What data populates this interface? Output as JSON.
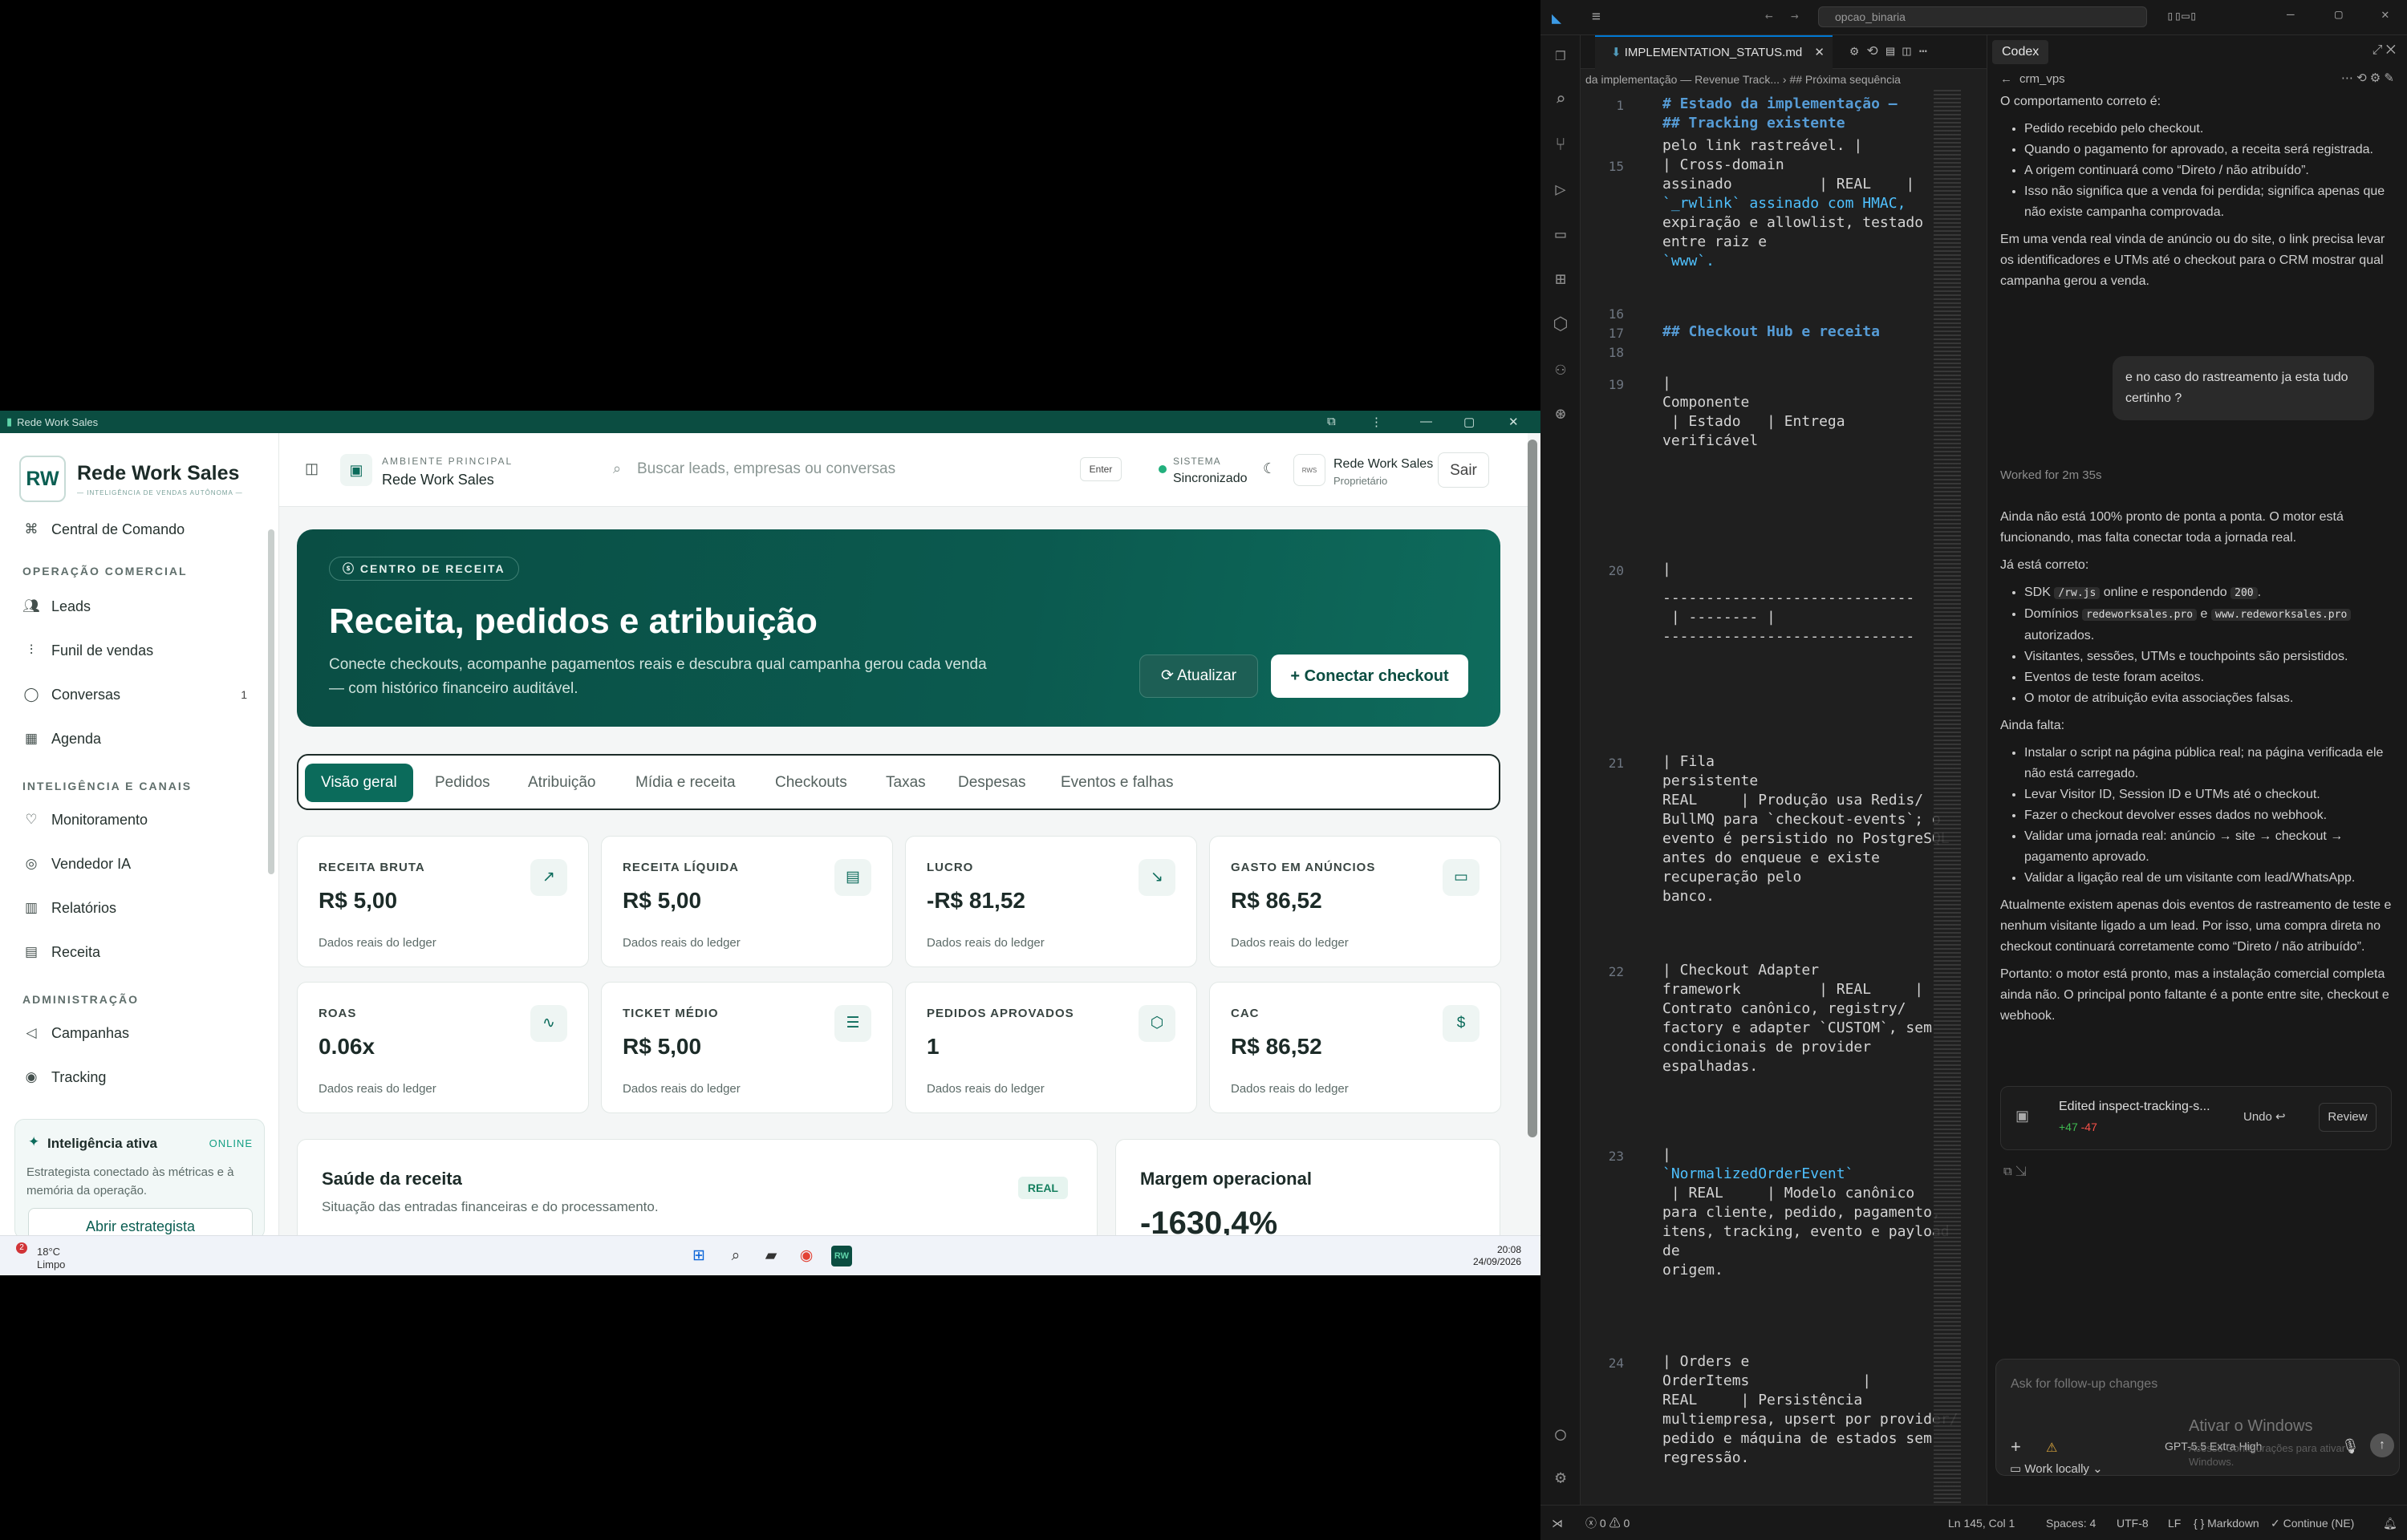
{
  "crm": {
    "window_title": "Rede Work Sales",
    "logo_initials": "RW",
    "logo_name": "Rede Work Sales",
    "logo_tagline": "— INTELIGÊNCIA DE VENDAS AUTÔNOMA —",
    "sidebar": {
      "top_item": "Central de Comando",
      "sections": [
        {
          "label": "OPERAÇÃO COMERCIAL",
          "items": [
            {
              "label": "Leads",
              "icon": "users-icon"
            },
            {
              "label": "Funil de vendas",
              "icon": "funnel-icon"
            },
            {
              "label": "Conversas",
              "icon": "chat-icon",
              "count": "1"
            },
            {
              "label": "Agenda",
              "icon": "calendar-icon"
            }
          ]
        },
        {
          "label": "INTELIGÊNCIA E CANAIS",
          "items": [
            {
              "label": "Monitoramento",
              "icon": "heart-icon"
            },
            {
              "label": "Vendedor IA",
              "icon": "bot-icon"
            },
            {
              "label": "Relatórios",
              "icon": "bar-chart-icon"
            },
            {
              "label": "Receita",
              "icon": "receipt-icon"
            }
          ]
        },
        {
          "label": "ADMINISTRAÇÃO",
          "items": [
            {
              "label": "Campanhas",
              "icon": "megaphone-icon"
            },
            {
              "label": "Tracking",
              "icon": "target-icon"
            }
          ]
        }
      ],
      "ai_card": {
        "title": "Inteligência ativa",
        "status": "ONLINE",
        "desc": "Estrategista conectado às métricas e à memória da operação.",
        "button": "Abrir estrategista"
      }
    },
    "header": {
      "env_label": "AMBIENTE PRINCIPAL",
      "env_value": "Rede Work Sales",
      "search_placeholder": "Buscar leads, empresas ou conversas",
      "enter_key": "Enter",
      "system_label": "SISTEMA",
      "system_value": "Sincronizado",
      "user_name": "Rede Work Sales",
      "user_role": "Proprietário",
      "logout": "Sair"
    },
    "hero": {
      "pill": "CENTRO DE RECEITA",
      "title": "Receita, pedidos e atribuição",
      "subtitle": "Conecte checkouts, acompanhe pagamentos reais e descubra qual campanha gerou cada venda — com histórico financeiro auditável.",
      "btn_refresh": "Atualizar",
      "btn_connect": "Conectar checkout"
    },
    "tabs": [
      "Visão geral",
      "Pedidos",
      "Atribuição",
      "Mídia e receita",
      "Checkouts",
      "Taxas",
      "Despesas",
      "Eventos e falhas"
    ],
    "cards": [
      {
        "title": "RECEITA BRUTA",
        "value": "R$ 5,00",
        "foot": "Dados reais do ledger",
        "icon": "trend-up-icon"
      },
      {
        "title": "RECEITA LÍQUIDA",
        "value": "R$ 5,00",
        "foot": "Dados reais do ledger",
        "icon": "wallet-icon"
      },
      {
        "title": "LUCRO",
        "value": "-R$ 81,52",
        "foot": "Dados reais do ledger",
        "icon": "trend-down-icon"
      },
      {
        "title": "GASTO EM ANÚNCIOS",
        "value": "R$ 86,52",
        "foot": "Dados reais do ledger",
        "icon": "card-icon"
      },
      {
        "title": "ROAS",
        "value": "0.06x",
        "foot": "Dados reais do ledger",
        "icon": "pulse-icon"
      },
      {
        "title": "TICKET MÉDIO",
        "value": "R$ 5,00",
        "foot": "Dados reais do ledger",
        "icon": "ticket-icon"
      },
      {
        "title": "PEDIDOS APROVADOS",
        "value": "1",
        "foot": "Dados reais do ledger",
        "icon": "package-icon"
      },
      {
        "title": "CAC",
        "value": "R$ 86,52",
        "foot": "Dados reais do ledger",
        "icon": "dollar-icon"
      }
    ],
    "health": {
      "title": "Saúde da receita",
      "subtitle": "Situação das entradas financeiras e do processamento.",
      "badge": "REAL"
    },
    "margin": {
      "title": "Margem operacional",
      "value": "-1630,4%"
    }
  },
  "taskbar": {
    "weather_temp": "18°C",
    "weather_desc": "Limpo",
    "weather_badge": "2",
    "time": "20:08",
    "date": "24/09/2026"
  },
  "vscode": {
    "command_center": "opcao_binaria",
    "editor_tab": "IMPLEMENTATION_STATUS.md",
    "breadcrumb": "da implementação — Revenue Track... › ## Próxima sequência",
    "lines": [
      {
        "n": "1",
        "t": "# Estado da implementação —",
        "k": "h"
      },
      {
        "n": "",
        "t": "## Tracking existente",
        "k": "h"
      },
      {
        "n": "",
        "t": "pelo link rastreável. |",
        "k": ""
      },
      {
        "n": "15",
        "t": "| Cross-domain",
        "k": ""
      },
      {
        "n": "",
        "t": "assinado          | REAL    |",
        "k": ""
      },
      {
        "n": "",
        "t": "`_rwlink` assinado com HMAC,",
        "k": "c"
      },
      {
        "n": "",
        "t": "expiração e allowlist, testado",
        "k": ""
      },
      {
        "n": "",
        "t": "entre raiz e",
        "k": ""
      },
      {
        "n": "",
        "t": "`www`.",
        "k": "c"
      },
      {
        "n": "16",
        "t": "",
        "k": ""
      },
      {
        "n": "17",
        "t": "## Checkout Hub e receita",
        "k": "h"
      },
      {
        "n": "18",
        "t": "",
        "k": ""
      },
      {
        "n": "19",
        "t": "|",
        "k": ""
      },
      {
        "n": "",
        "t": "Componente",
        "k": ""
      },
      {
        "n": "",
        "t": " | Estado   | Entrega",
        "k": ""
      },
      {
        "n": "",
        "t": "verificável",
        "k": ""
      },
      {
        "n": "20",
        "t": "|",
        "k": ""
      },
      {
        "n": "",
        "t": "-----------------------------",
        "k": ""
      },
      {
        "n": "",
        "t": " | -------- |",
        "k": ""
      },
      {
        "n": "",
        "t": "-----------------------------",
        "k": ""
      },
      {
        "n": "21",
        "t": "| Fila",
        "k": ""
      },
      {
        "n": "",
        "t": "persistente",
        "k": ""
      },
      {
        "n": "",
        "t": "REAL     | Produção usa Redis/",
        "k": ""
      },
      {
        "n": "",
        "t": "BullMQ para `checkout-events`; o",
        "k": ""
      },
      {
        "n": "",
        "t": "evento é persistido no PostgreSQL",
        "k": ""
      },
      {
        "n": "",
        "t": "antes do enqueue e existe",
        "k": ""
      },
      {
        "n": "",
        "t": "recuperação pelo",
        "k": ""
      },
      {
        "n": "",
        "t": "banco.",
        "k": ""
      },
      {
        "n": "22",
        "t": "| Checkout Adapter",
        "k": ""
      },
      {
        "n": "",
        "t": "framework         | REAL     |",
        "k": ""
      },
      {
        "n": "",
        "t": "Contrato canônico, registry/",
        "k": ""
      },
      {
        "n": "",
        "t": "factory e adapter `CUSTOM`, sem",
        "k": ""
      },
      {
        "n": "",
        "t": "condicionais de provider",
        "k": ""
      },
      {
        "n": "",
        "t": "espalhadas.",
        "k": ""
      },
      {
        "n": "23",
        "t": "|",
        "k": ""
      },
      {
        "n": "",
        "t": "`NormalizedOrderEvent`",
        "k": "c"
      },
      {
        "n": "",
        "t": " | REAL     | Modelo canônico",
        "k": ""
      },
      {
        "n": "",
        "t": "para cliente, pedido, pagamento,",
        "k": ""
      },
      {
        "n": "",
        "t": "itens, tracking, evento e payload",
        "k": ""
      },
      {
        "n": "",
        "t": "de",
        "k": ""
      },
      {
        "n": "",
        "t": "origem.",
        "k": ""
      },
      {
        "n": "24",
        "t": "| Orders e",
        "k": ""
      },
      {
        "n": "",
        "t": "OrderItems             |",
        "k": ""
      },
      {
        "n": "",
        "t": "REAL     | Persistência",
        "k": ""
      },
      {
        "n": "",
        "t": "multiempresa, upsert por provider/",
        "k": ""
      },
      {
        "n": "",
        "t": "pedido e máquina de estados sem",
        "k": ""
      },
      {
        "n": "",
        "t": "regressão.",
        "k": ""
      }
    ],
    "codex": {
      "tab": "Codex",
      "project": "crm_vps",
      "intro": "O comportamento correto é:",
      "bullets1": [
        "Pedido recebido pelo checkout.",
        "Quando o pagamento for aprovado, a receita será registrada.",
        "A origem continuará como “Direto / não atribuído”.",
        "Isso não significa que a venda foi perdida; significa apenas que não existe campanha comprovada."
      ],
      "para1": "Em uma venda real vinda de anúncio ou do site, o link precisa levar os identificadores e UTMs até o checkout para o CRM mostrar qual campanha gerou a venda.",
      "user_msg": "e no caso do rastreamento ja esta tudo certinho ?",
      "worked": "Worked for 2m 35s",
      "para2": "Ainda não está 100% pronto de ponta a ponta. O motor está funcionando, mas falta conectar toda a jornada real.",
      "ok_label": "Já está correto:",
      "ok_sdk_a": "SDK",
      "ok_sdk_code": "/rw.js",
      "ok_sdk_b": "online e respondendo",
      "ok_sdk_code2": "200",
      "ok_dom_a": "Domínios",
      "ok_dom_code1": "redeworksales.pro",
      "ok_dom_b": "e",
      "ok_dom_code2": "www.redeworksales.pro",
      "ok_dom_c": "autorizados.",
      "ok_rest": [
        "Visitantes, sessões, UTMs e touchpoints são persistidos.",
        "Eventos de teste foram aceitos.",
        "O motor de atribuição evita associações falsas."
      ],
      "missing_label": "Ainda falta:",
      "missing": [
        "Instalar o script na página pública real; na página verificada ele não está carregado.",
        "Levar Visitor ID, Session ID e UTMs até o checkout.",
        "Fazer o checkout devolver esses dados no webhook.",
        "Validar uma jornada real: anúncio → site → checkout → pagamento aprovado.",
        "Validar a ligação real de um visitante com lead/WhatsApp."
      ],
      "para3": "Atualmente existem apenas dois eventos de rastreamento de teste e nenhum visitante ligado a um lead. Por isso, uma compra direta no checkout continuará corretamente como “Direto / não atribuído”.",
      "para4": "Portanto: o motor está pronto, mas a instalação comercial completa ainda não. O principal ponto faltante é a ponte entre site, checkout e webhook.",
      "edit_file": "Edited inspect-tracking-s...",
      "edit_plus": "+47",
      "edit_minus": "-47",
      "undo": "Undo",
      "review": "Review",
      "input_placeholder": "Ask for follow-up changes",
      "model": "GPT-5.5 Extra High",
      "work_locally": "Work locally",
      "watermark1": "Ativar o Windows",
      "watermark2": "Acesse Configurações para ativar o Windows."
    },
    "status": {
      "problems_err": "0",
      "problems_warn": "0",
      "position": "Ln 145, Col 1",
      "spaces": "Spaces: 4",
      "encoding": "UTF-8",
      "eol": "LF",
      "language": "Markdown",
      "continue": "Continue (NE)"
    }
  }
}
